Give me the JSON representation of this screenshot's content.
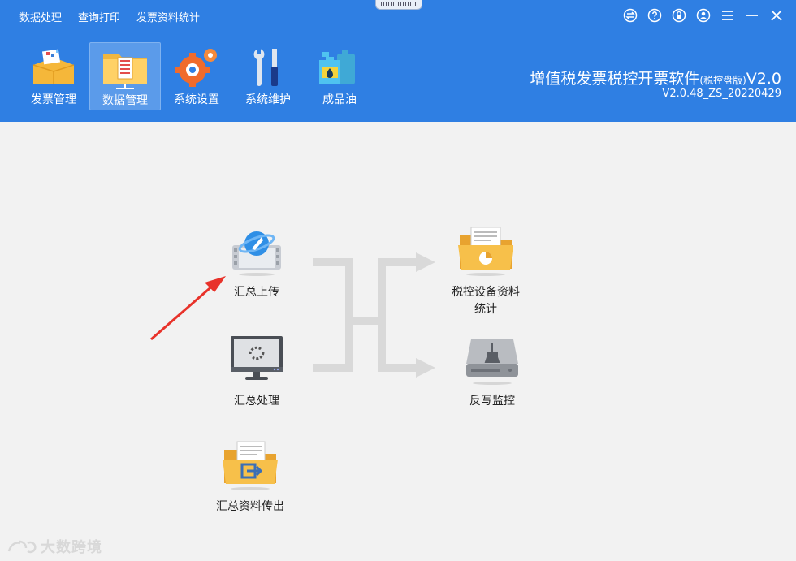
{
  "menu": [
    "数据处理",
    "查询打印",
    "发票资料统计"
  ],
  "window_controls": [
    "switch-icon",
    "help-icon",
    "lock-icon",
    "user-icon",
    "menu-icon",
    "minimize-icon",
    "close-icon"
  ],
  "toolbar": [
    {
      "label": "发票管理",
      "icon": "invoice-box-icon",
      "active": false
    },
    {
      "label": "数据管理",
      "icon": "data-folder-icon",
      "active": true
    },
    {
      "label": "系统设置",
      "icon": "gear-icon",
      "active": false
    },
    {
      "label": "系统维护",
      "icon": "tools-icon",
      "active": false
    },
    {
      "label": "成品油",
      "icon": "oil-can-icon",
      "active": false
    }
  ],
  "app": {
    "title": "增值税发票税控开票软件",
    "title_suffix": "(税控盘版)",
    "title_version": "V2.0",
    "build": "V2.0.48_ZS_20220429"
  },
  "functions": {
    "upload_summary": "汇总上传",
    "process_summary": "汇总处理",
    "export_summary": "汇总资料传出",
    "device_stats_line1": "税控设备资料",
    "device_stats_line2": "统计",
    "write_back_monitor": "反写监控"
  },
  "watermark": "大数跨境",
  "colors": {
    "header": "#2f7fe3",
    "background": "#f2f2f2",
    "annotation_arrow": "#e8322a"
  }
}
